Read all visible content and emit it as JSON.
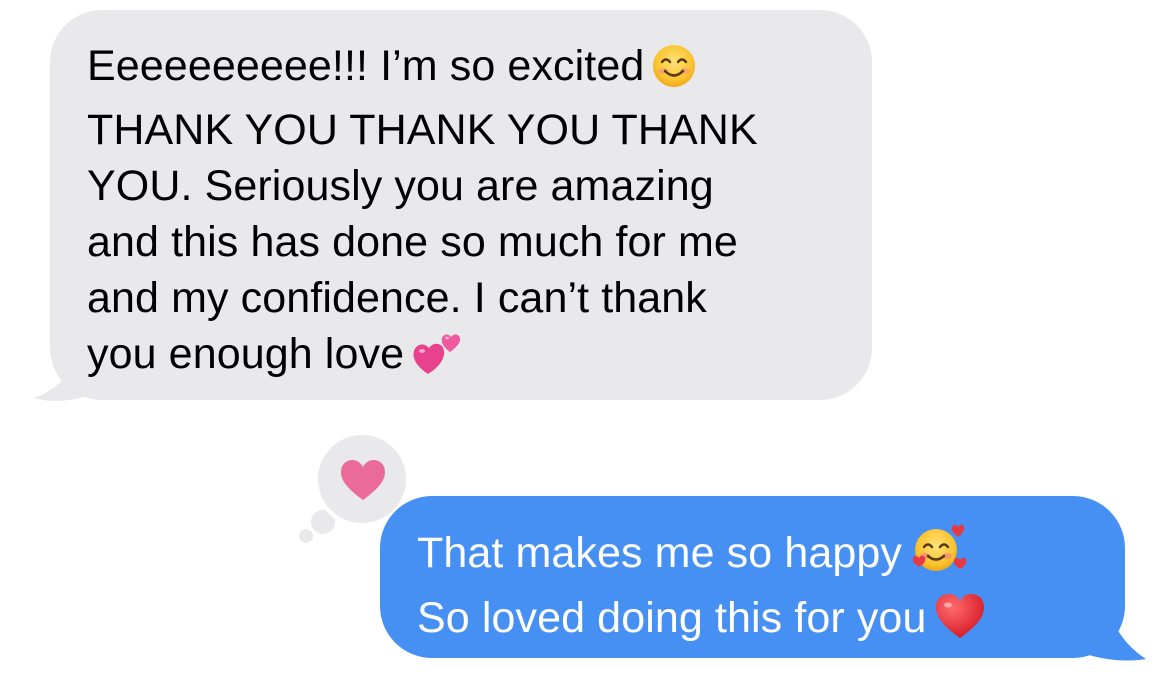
{
  "conversation": {
    "incoming": {
      "lines": [
        "Eeeeeeeeee!!! I’m so excited",
        "THANK YOU THANK YOU THANK",
        "YOU. Seriously you are amazing",
        "and this has done so much for me",
        "and my confidence. I can’t thank",
        "you enough love"
      ],
      "emojis": {
        "line1": "smiling-face-emoji",
        "line6": "two-hearts-emoji"
      },
      "bubble_color": "#e9e9eb",
      "text_color": "#000000"
    },
    "reaction": {
      "type": "heart",
      "icon": "heart-icon",
      "color": "#e9669a",
      "bubble_color": "#e9e9eb"
    },
    "outgoing": {
      "lines": [
        "That makes me so happy",
        "So loved doing this for you"
      ],
      "emojis": {
        "line1": "smiling-face-with-hearts-emoji",
        "line2": "red-heart-emoji"
      },
      "bubble_color": "#4690f3",
      "text_color": "#ffffff"
    }
  }
}
